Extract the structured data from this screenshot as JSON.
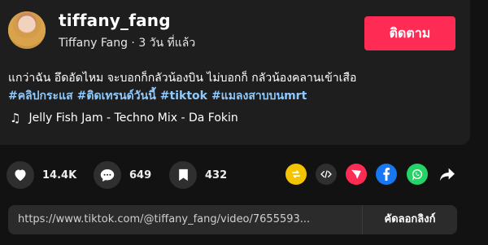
{
  "post": {
    "username": "tiffany_fang",
    "display_name": "Tiffany Fang",
    "separator": " · ",
    "time_ago": "3 วัน ที่แล้ว",
    "follow_label": "ติดตาม",
    "caption": "แกว่าฉัน อึดอัดไหม จะบอกก็กลัวน้องบิน ไม่บอกก็ กลัวน้องคลานเข้าเสือ",
    "hashtags": [
      "#คลิปกระแส",
      "#ติดเทรนด์วันนี้",
      "#tiktok",
      "#แมลงสาบบนmrt"
    ],
    "music_note": "♫",
    "music": "Jelly Fish Jam - Techno Mix - Da Fokin"
  },
  "actions": {
    "likes": "14.4K",
    "comments": "649",
    "saves": "432"
  },
  "share": {
    "icons": [
      "repost-icon",
      "embed-icon",
      "send-icon",
      "facebook-icon",
      "whatsapp-icon",
      "share-arrow-icon"
    ],
    "colors": {
      "repost": "#f5c400",
      "embed": "#2f2f2f",
      "send": "#fe2c55",
      "facebook": "#1877f2",
      "whatsapp": "#25d366"
    }
  },
  "link": {
    "url": "https://www.tiktok.com/@tiffany_fang/video/7655593...",
    "copy_label": "คัดลอกลิงก์"
  }
}
